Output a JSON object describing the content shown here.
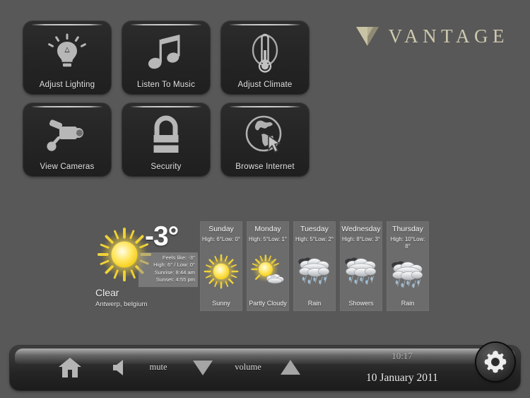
{
  "brand": {
    "name": "VANTAGE",
    "mark_icon": "vantage-chevron-icon",
    "mark_color": "#c9c3a6"
  },
  "tiles": [
    {
      "label": "Adjust Lighting",
      "icon": "lightbulb-icon"
    },
    {
      "label": "Listen To Music",
      "icon": "music-note-icon"
    },
    {
      "label": "Adjust Climate",
      "icon": "thermometer-icon"
    },
    {
      "label": "View Cameras",
      "icon": "security-camera-icon"
    },
    {
      "label": "Security",
      "icon": "padlock-icon"
    },
    {
      "label": "Browse Internet",
      "icon": "globe-cursor-icon"
    }
  ],
  "weather": {
    "current": {
      "icon": "sun-icon",
      "temperature": "-3°",
      "condition": "Clear",
      "location": "Antwerp, belgium",
      "details": [
        "Feels like: -3°",
        "High: 6° / Low: 0°",
        "Sunrise: 8:44 am",
        "Sunset: 4:55 pm"
      ]
    },
    "forecast": [
      {
        "day": "Sunday",
        "highlow": "High: 6°Low: 0°",
        "condition": "Sunny",
        "icon": "sun-icon"
      },
      {
        "day": "Monday",
        "highlow": "High: 5°Low: 1°",
        "condition": "Partly Cloudy",
        "icon": "sun-cloud-icon"
      },
      {
        "day": "Tuesday",
        "highlow": "High: 5°Low: 2°",
        "condition": "Rain",
        "icon": "rain-cloud-icon"
      },
      {
        "day": "Wednesday",
        "highlow": "High: 8°Low: 3°",
        "condition": "Showers",
        "icon": "rain-cloud-icon"
      },
      {
        "day": "Thursday",
        "highlow": "High: 10°Low: 8°",
        "condition": "Rain",
        "icon": "rain-cloud-icon"
      }
    ]
  },
  "toolbar": {
    "home_icon": "home-icon",
    "mute_icon": "speaker-mute-icon",
    "mute_label": "mute",
    "volume_down_icon": "triangle-down-icon",
    "volume_label": "volume",
    "volume_up_icon": "triangle-up-icon",
    "time": "10:17",
    "date": "10 January 2011",
    "settings_icon": "gear-icon"
  }
}
